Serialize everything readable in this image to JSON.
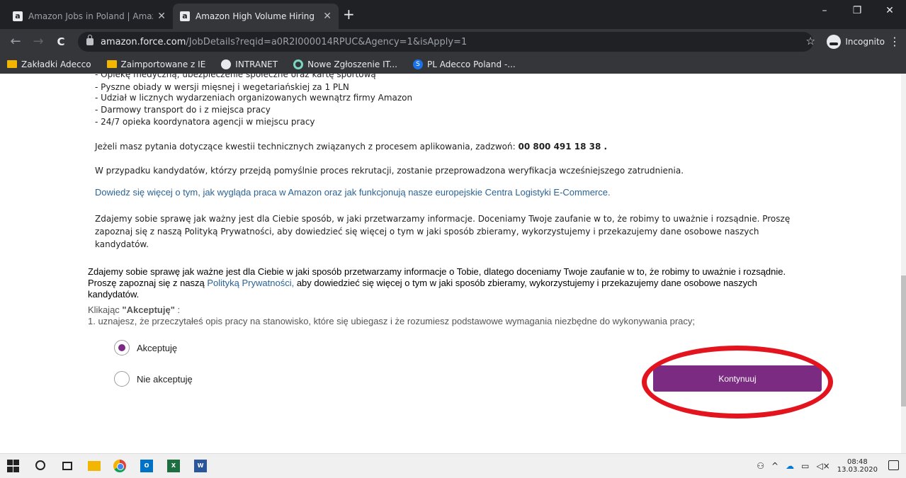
{
  "browser": {
    "tabs": [
      {
        "title": "Amazon Jobs in Poland | Amazon",
        "favicon": "a"
      },
      {
        "title": "Amazon High Volume Hiring",
        "favicon": "a"
      }
    ],
    "new_tab": "+",
    "window": {
      "minimize": "–",
      "maximize": "❐",
      "close": "✕"
    },
    "nav": {
      "back": "←",
      "forward": "→",
      "reload": "C"
    },
    "url_domain": "amazon.force.com",
    "url_path": "/JobDetails?reqid=a0R2I000014RPUC&Agency=1&isApply=1",
    "star": "☆",
    "incognito_label": "Incognito",
    "menu": "⋮"
  },
  "bookmarks": [
    {
      "label": "Zakładki Adecco",
      "icon": "folder-icon"
    },
    {
      "label": "Zaimportowane z IE",
      "icon": "folder-icon"
    },
    {
      "label": "INTRANET",
      "icon": "globe-icon"
    },
    {
      "label": "Nowe Zgłoszenie IT...",
      "icon": "ring-icon"
    },
    {
      "label": "PL Adecco Poland -...",
      "icon": "sharepoint-icon",
      "icon_text": "S"
    }
  ],
  "content": {
    "bullets": [
      "- Opiekę medyczną, ubezpieczenie społeczne oraz kartę sportową",
      "- Pyszne obiady w wersji mięsnej i wegetariańskiej za 1 PLN",
      "- Udział w licznych wydarzeniach organizowanych wewnątrz firmy Amazon",
      "- Darmowy transport do i z miejsca pracy",
      "- 24/7 opieka koordynatora agencji w miejscu pracy"
    ],
    "tech_question": "Jeżeli masz pytania dotyczące kwestii technicznych związanych z procesem aplikowania, zadzwoń:",
    "tech_phone": "00 800 491 18 38 .",
    "verification": "W przypadku kandydatów, którzy przejdą pomyślnie proces rekrutacji, zostanie przeprowadzona weryfikacja wcześniejszego zatrudnienia.",
    "learn_more_link": "Dowiedz się więcej o tym, jak wygląda praca w Amazon oraz jak funkcjonują nasze europejskie Centra Logistyki E-Commerce.",
    "privacy_paragraph": "Zdajemy sobie sprawę jak ważny jest dla Ciebie sposób, w jaki przetwarzamy informacje. Doceniamy Twoje zaufanie w to, że robimy to uważnie i rozsądnie. Proszę zapoznaj się z naszą  Polityką Prywatności,  aby dowiedzieć się więcej o tym w jaki sposób zbieramy, wykorzystujemy i przekazujemy dane osobowe naszych kandydatów."
  },
  "consent": {
    "text_before": "Zdajemy sobie sprawę jak ważne jest dla Ciebie w jaki sposób przetwarzamy informacje o Tobie, dlatego doceniamy Twoje zaufanie w to, że robimy to uważnie i rozsądnie. Proszę zapoznaj się z naszą ",
    "privacy_link": "Polityką Prywatności,",
    "text_after": " aby dowiedzieć się więcej o tym w jaki sposób zbieramy, wykorzystujemy i przekazujemy dane osobowe naszych kandydatów.",
    "click_prefix": "Klikając ",
    "click_bold": "\"Akceptuję\"",
    "click_suffix": ":",
    "point1": "1. uznajesz, że przeczytałeś opis pracy na stanowisko, które się ubiegasz i że rozumiesz podstawowe wymagania niezbędne do wykonywania pracy;",
    "accept_label": "Akceptuję",
    "decline_label": "Nie akceptuję",
    "selected": "accept",
    "continue_label": "Kontynuuj"
  },
  "colors": {
    "accent": "#7b2b82",
    "annotation": "#e3141d",
    "link": "#2a6396"
  },
  "taskbar": {
    "apps": [
      "windows-start",
      "search",
      "task-view",
      "file-explorer",
      "chrome",
      "outlook",
      "excel",
      "word"
    ],
    "outlook_text": "O",
    "excel_text": "X",
    "word_text": "W",
    "time": "08:48",
    "date": "13.03.2020"
  }
}
